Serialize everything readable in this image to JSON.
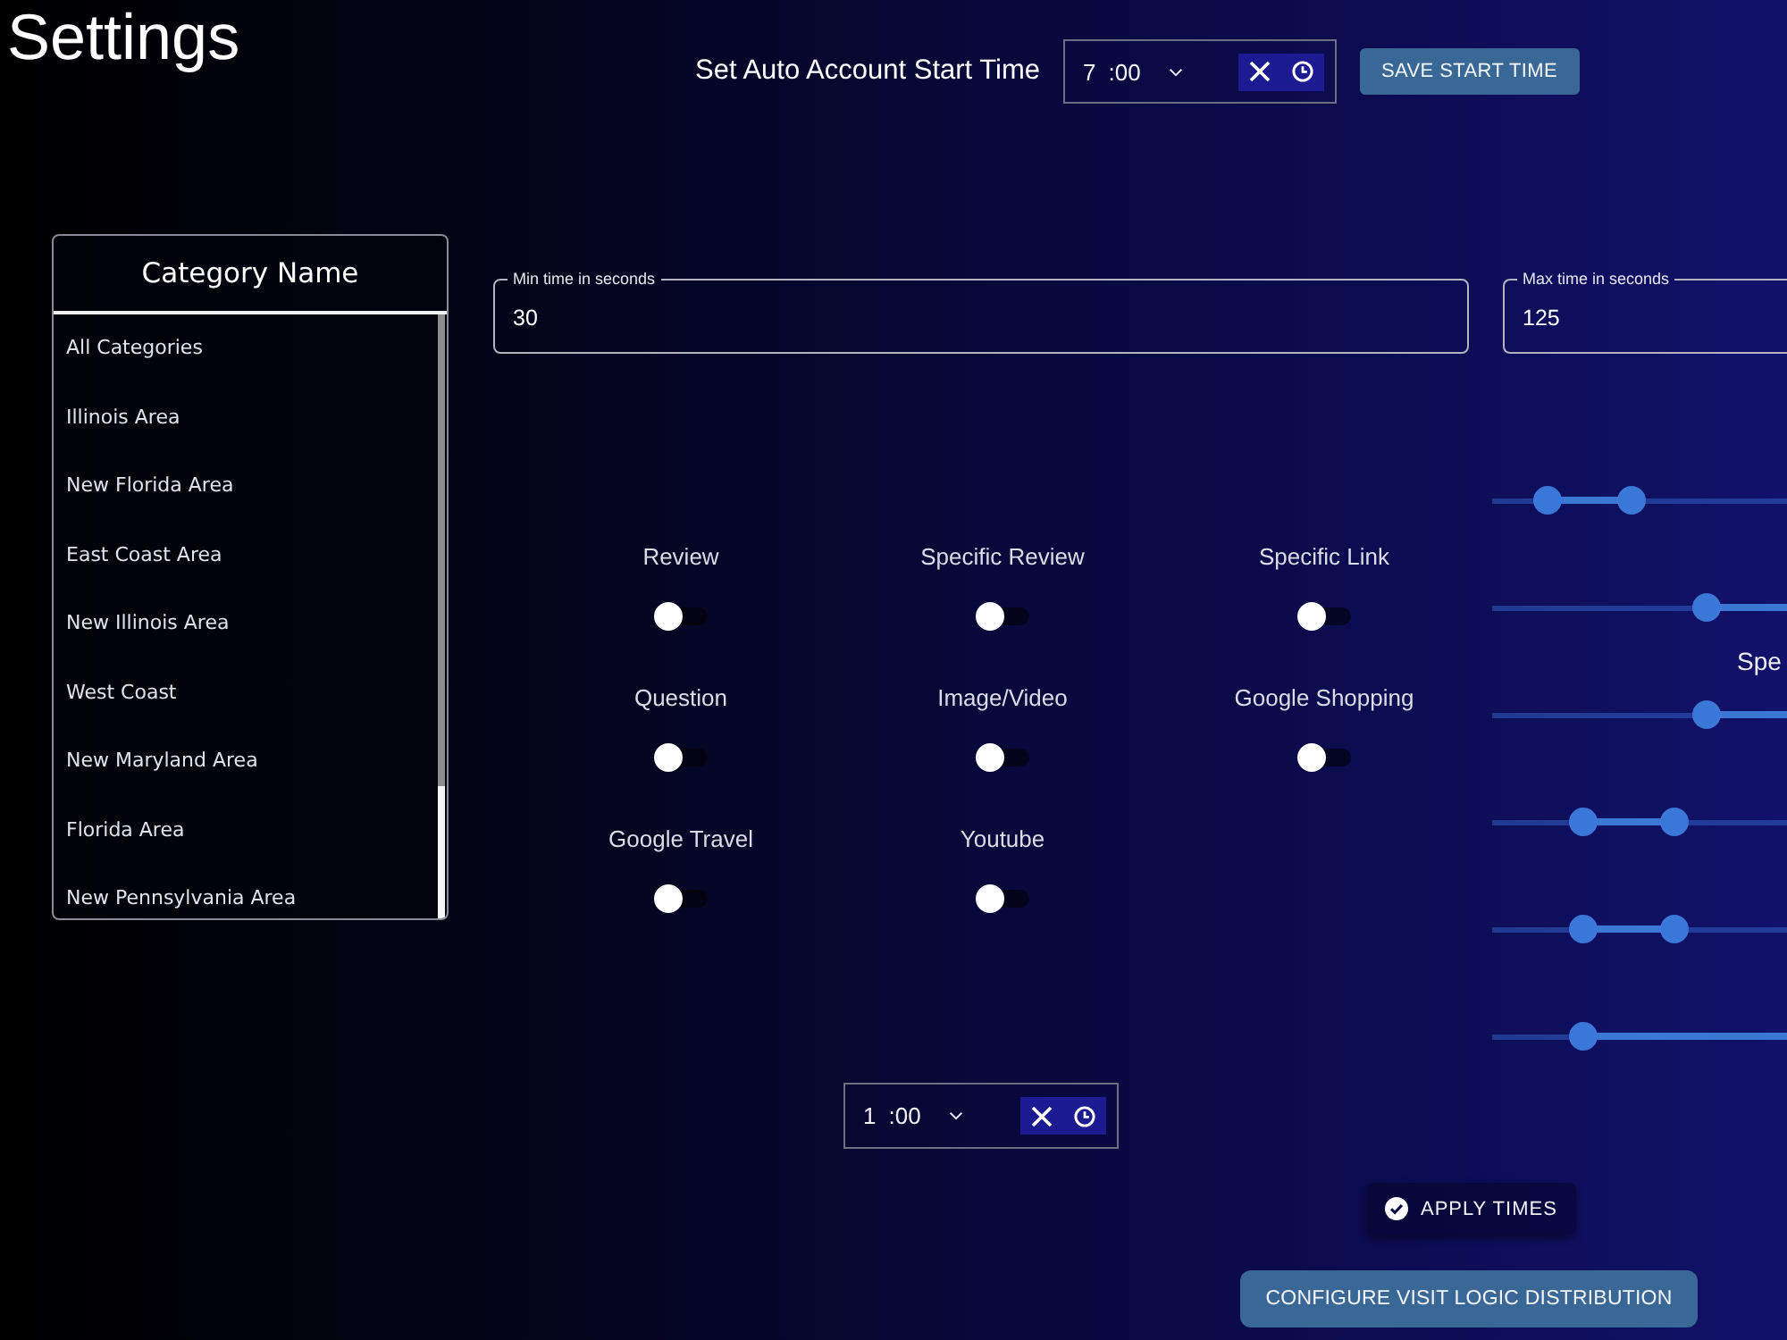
{
  "page": {
    "title": "Settings"
  },
  "start_time": {
    "label": "Set Auto Account Start Time",
    "hour": "7",
    "minutes": ":00",
    "button": "SAVE START TIME"
  },
  "categories": {
    "header": "Category Name",
    "items": [
      "All Categories",
      "Illinois Area",
      "New Florida Area",
      "East Coast Area",
      "New Illinois Area",
      "West Coast",
      "New Maryland Area",
      "Florida Area",
      "New Pennsylvania Area"
    ]
  },
  "time_fields": [
    {
      "label": "Min time in seconds",
      "value": "30"
    },
    {
      "label": "Max time in seconds",
      "value": "125"
    }
  ],
  "toggles": [
    {
      "label": "Review",
      "on": false
    },
    {
      "label": "Specific Review",
      "on": false
    },
    {
      "label": "Specific Link",
      "on": false
    },
    {
      "label": "Question",
      "on": false
    },
    {
      "label": "Image/Video",
      "on": false
    },
    {
      "label": "Google Shopping",
      "on": false
    },
    {
      "label": "Google Travel",
      "on": false
    },
    {
      "label": "Youtube",
      "on": false
    }
  ],
  "sliders": [
    {
      "kind": "range",
      "thumbs": [
        {
          "level": 0.19
        },
        {
          "level": 0.47
        }
      ]
    },
    {
      "kind": "inverted",
      "thumbs": [
        {
          "level": 0.73
        }
      ],
      "caption": "Spe"
    },
    {
      "kind": "inverted",
      "thumbs": [
        {
          "level": 0.73
        }
      ]
    },
    {
      "kind": "range",
      "thumbs": [
        {
          "level": 0.31
        },
        {
          "level": 0.62
        }
      ]
    },
    {
      "kind": "range",
      "thumbs": [
        {
          "level": 0.31
        },
        {
          "level": 0.62
        }
      ]
    },
    {
      "kind": "inverted",
      "thumbs": [
        {
          "level": 0.31
        }
      ]
    }
  ],
  "end_time": {
    "hour": "1",
    "minutes": ":00"
  },
  "apply_button": "APPLY TIMES",
  "configure_button": "CONFIGURE VISIT LOGIC DISTRIBUTION"
}
